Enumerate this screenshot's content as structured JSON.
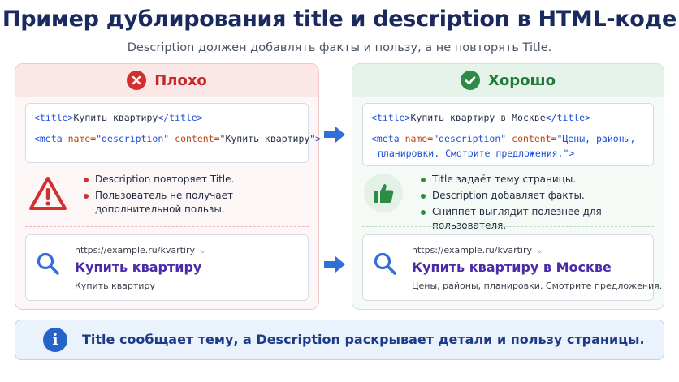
{
  "header": {
    "title": "Пример дублирования title и description в HTML-коде",
    "subtitle": "Description должен добавлять факты и пользу, а не повторять Title."
  },
  "bad": {
    "label": "Плохо",
    "code": {
      "line1_open": "<title>",
      "line1_text": "Купить квартиру",
      "line1_close": "</title>",
      "line2_tag": "<meta",
      "line2_attr1": "name=",
      "line2_val1": "\"description\"",
      "line2_attr2": "content=",
      "line2_val2": "\"Купить квартиру\"",
      "line2_end": ">"
    },
    "notes": [
      "Description повторяет Title.",
      "Пользователь не получает",
      "дополнительной пользы."
    ],
    "serp": {
      "url": "https://example.ru/kvartiry",
      "title": "Купить квартиру",
      "description": "Купить квартиру"
    }
  },
  "good": {
    "label": "Хорошо",
    "code": {
      "line1_open": "<title>",
      "line1_text": "Купить квартиру в Москве",
      "line1_close": "</title>",
      "line2_tag": "<meta",
      "line2_attr1": "name=",
      "line2_val1": "\"description\"",
      "line2_attr2": "content=",
      "line2_val2a": "\"Цены, районы,",
      "line3_val2b": "планировки. Смотрите предложения.\"",
      "line3_end": ">"
    },
    "notes": [
      "Title задаёт тему страницы.",
      "Description добавляет факты.",
      "Сниппет выглядит полезнее для пользователя."
    ],
    "serp": {
      "url": "https://example.ru/kvartiry",
      "title": "Купить квартиру в Москве",
      "description": "Цены, районы, планировки. Смотрите предложения."
    }
  },
  "info": {
    "text": "Title сообщает тему, а Description раскрывает детали и пользу страницы."
  },
  "colors": {
    "bad_accent": "#d32f2f",
    "good_accent": "#2e8b45",
    "serp_title": "#4c2aa8",
    "arrow": "#2f6fd6",
    "info_icon": "#2563c9"
  },
  "icons": {
    "bad_header": "x-circle-icon",
    "good_header": "check-circle-icon",
    "bad_note": "warning-triangle-icon",
    "good_note": "thumbs-up-icon",
    "serp": "search-icon",
    "info": "info-icon",
    "arrow": "arrow-right-icon"
  }
}
